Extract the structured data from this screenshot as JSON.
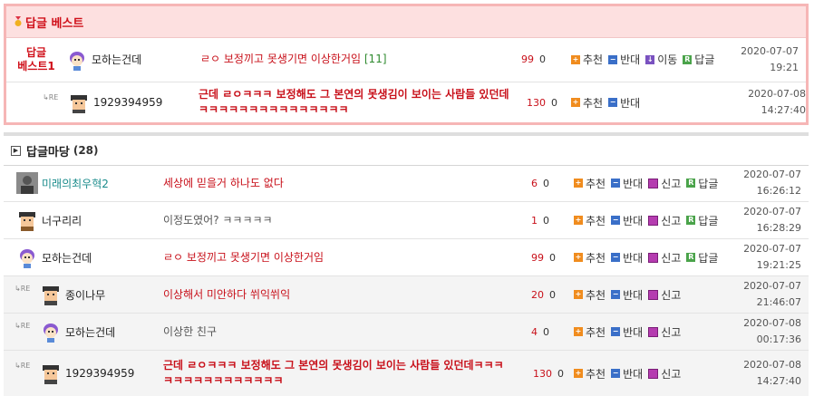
{
  "best": {
    "title": "답글 베스트",
    "rows": [
      {
        "label": "답글\n베스트1",
        "nick": "모하는건데",
        "content": "ㄹㅇ 보정끼고 못생기면 이상한거임",
        "reply_count": "[11]",
        "up": "99",
        "down": "0",
        "buttons": [
          "추천",
          "반대",
          "이동",
          "답글"
        ],
        "date": "2020-07-07",
        "time": "19:21"
      },
      {
        "re": "RE",
        "nick": "1929394959",
        "content": "근데 ㄹㅇㅋㅋㅋ 보정해도 그 본연의 못생김이 보이는 사람들 있던데ㅋㅋㅋㅋㅋㅋㅋㅋㅋㅋㅋㅋㅋㅋㅋ",
        "up": "130",
        "down": "0",
        "buttons": [
          "추천",
          "반대"
        ],
        "date": "2020-07-08",
        "time": "14:27:40"
      }
    ]
  },
  "board": {
    "title": "답글마당",
    "count": "(28)",
    "rows": [
      {
        "nick": "미래의최우혁2",
        "content": "세상에 믿을거 하나도 없다",
        "up": "6",
        "down": "0",
        "buttons": [
          "추천",
          "반대",
          "신고",
          "답글"
        ],
        "date": "2020-07-07",
        "time": "16:26:12"
      },
      {
        "nick": "너구리리",
        "content": "이정도였어? ㅋㅋㅋㅋㅋ",
        "up": "1",
        "down": "0",
        "buttons": [
          "추천",
          "반대",
          "신고",
          "답글"
        ],
        "date": "2020-07-07",
        "time": "16:28:29"
      },
      {
        "nick": "모하는건데",
        "content": "ㄹㅇ 보정끼고 못생기면 이상한거임",
        "up": "99",
        "down": "0",
        "buttons": [
          "추천",
          "반대",
          "신고",
          "답글"
        ],
        "date": "2020-07-07",
        "time": "19:21:25"
      },
      {
        "re": "RE",
        "nick": "종이나무",
        "content": "이상해서 미안하다 쒸익쒸익",
        "up": "20",
        "down": "0",
        "buttons": [
          "추천",
          "반대",
          "신고"
        ],
        "date": "2020-07-07",
        "time": "21:46:07"
      },
      {
        "re": "RE",
        "nick": "모하는건데",
        "content": "이상한 친구",
        "up": "4",
        "down": "0",
        "buttons": [
          "추천",
          "반대",
          "신고"
        ],
        "date": "2020-07-08",
        "time": "00:17:36"
      },
      {
        "re": "RE",
        "nick": "1929394959",
        "content": "근데 ㄹㅇㅋㅋㅋ 보정해도 그 본연의 못생김이 보이는 사람들 있던데ㅋㅋㅋㅋㅋㅋㅋㅋㅋㅋㅋㅋㅋㅋㅋ",
        "up": "130",
        "down": "0",
        "buttons": [
          "추천",
          "반대",
          "신고"
        ],
        "date": "2020-07-08",
        "time": "14:27:40"
      }
    ]
  },
  "icons": {
    "plus": "plus-icon",
    "minus": "minus-icon",
    "move": "move-down-icon",
    "reply": "reply-icon",
    "report": "report-icon",
    "medal": "medal-icon",
    "re": "reply-arrow-icon"
  },
  "colors": {
    "accent_red": "#d0101a",
    "best_bg": "#fde0e0",
    "best_border": "#f6b6b6",
    "up_icon": "#f08c1e",
    "down_icon": "#3a6fc8"
  }
}
